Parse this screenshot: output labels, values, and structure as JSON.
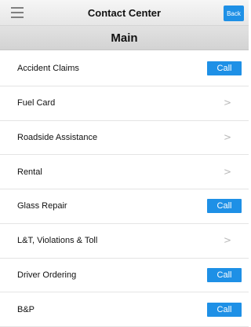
{
  "header": {
    "title": "Contact Center",
    "back_label": "Back",
    "menu_icon": "hamburger-menu-icon"
  },
  "section": {
    "title": "Main"
  },
  "items": [
    {
      "label": "Accident Claims",
      "action": "call",
      "action_label": "Call"
    },
    {
      "label": "Fuel Card",
      "action": "navigate",
      "icon": "chevron-right-icon"
    },
    {
      "label": "Roadside Assistance",
      "action": "navigate",
      "icon": "chevron-right-icon"
    },
    {
      "label": "Rental",
      "action": "navigate",
      "icon": "chevron-right-icon"
    },
    {
      "label": "Glass Repair",
      "action": "call",
      "action_label": "Call"
    },
    {
      "label": "L&T, Violations & Toll",
      "action": "navigate",
      "icon": "chevron-right-icon"
    },
    {
      "label": "Driver Ordering",
      "action": "call",
      "action_label": "Call"
    },
    {
      "label": "B&P",
      "action": "call",
      "action_label": "Call"
    }
  ],
  "colors": {
    "accent": "#1e90e6",
    "chevron": "#b8b8b8"
  }
}
